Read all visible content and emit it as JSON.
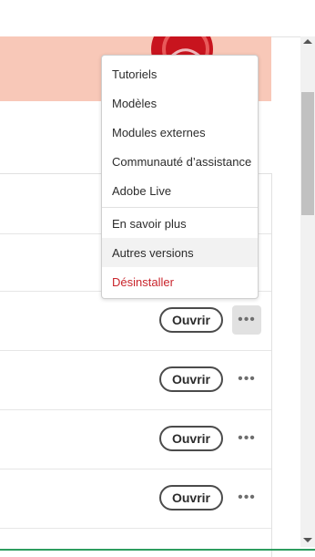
{
  "menu": {
    "items": [
      {
        "label": "Tutoriels"
      },
      {
        "label": "Modèles"
      },
      {
        "label": "Modules externes"
      },
      {
        "label": "Communauté d’assistance"
      },
      {
        "label": "Adobe Live"
      },
      {
        "label": "En savoir plus"
      },
      {
        "label": "Autres versions"
      },
      {
        "label": "Désinstaller"
      }
    ]
  },
  "rows": [
    {
      "open_label": "Ouvrir"
    },
    {
      "open_label": "Ouvrir"
    },
    {
      "open_label": "Ouvrir"
    },
    {
      "open_label": "Ouvrir"
    }
  ],
  "colors": {
    "banner": "#f8c8b8",
    "danger": "#c9252c",
    "accent_red": "#c8141e"
  },
  "icons": {
    "more": "more-horizontal-icon",
    "art": "adobe-app-artwork"
  }
}
